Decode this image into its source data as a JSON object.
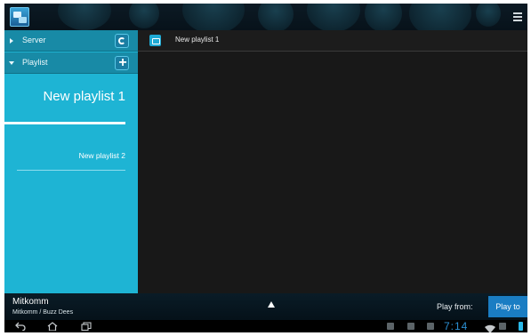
{
  "colors": {
    "accent": "#1eb4d4",
    "accent_dark": "#188aa6",
    "button_blue": "#1a7dc3",
    "clock": "#2b8fd2"
  },
  "actionbar": {
    "app_icon": "media-share-app-icon",
    "menu_icon": "overflow-menu-icon"
  },
  "sidebar": {
    "server": {
      "label": "Server",
      "expand_icon": "collapsed-arrow-icon",
      "action_icon": "refresh-icon"
    },
    "playlist": {
      "label": "Playlist",
      "expand_icon": "expanded-arrow-icon",
      "action_icon": "add-icon"
    },
    "playlists": [
      {
        "label": "New playlist 1",
        "selected": true
      },
      {
        "label": "New playlist 2",
        "selected": false
      }
    ]
  },
  "main": {
    "header_icon": "playlist-folder-icon",
    "title": "New playlist 1"
  },
  "now_playing": {
    "title": "Mitkomm",
    "subtitle": "Mitkomm / Buzz Dees",
    "expand_icon": "expand-up-icon",
    "play_from_label": "Play from:",
    "play_to_label": "Play to"
  },
  "system_bar": {
    "nav_icons": [
      "back-icon",
      "home-icon",
      "recent-apps-icon"
    ],
    "clock": "7:14"
  }
}
